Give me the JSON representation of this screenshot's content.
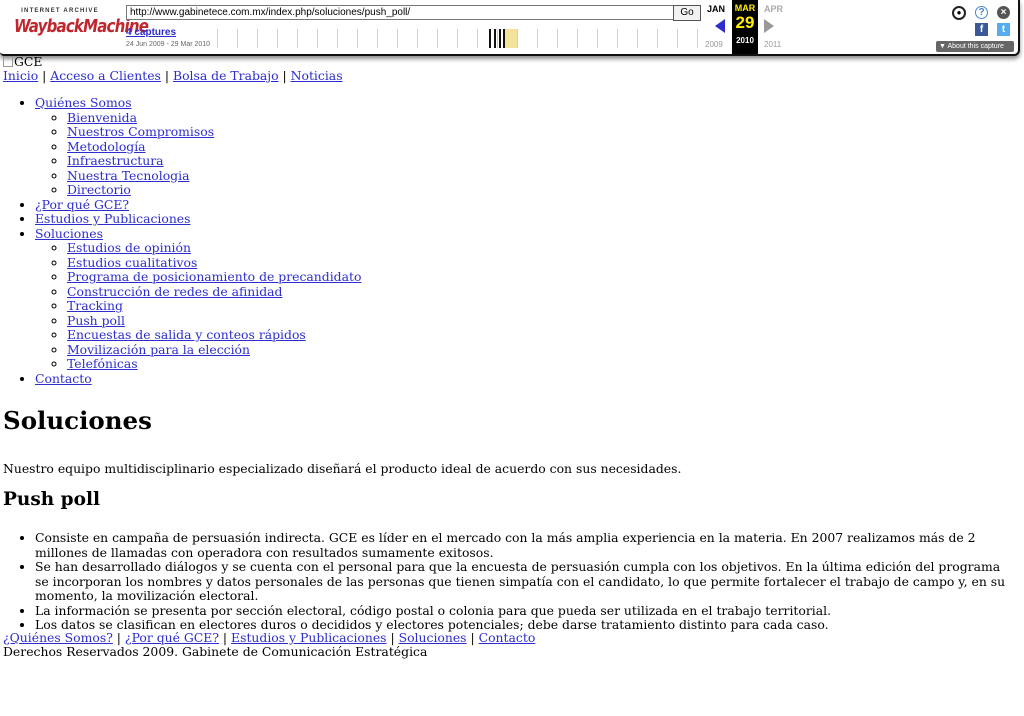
{
  "wayback": {
    "logo_top": "INTERNET ARCHIVE",
    "logo_main": "WaybackMachine",
    "url": "http://www.gabinetece.com.mx/index.php/soluciones/push_poll/",
    "go_label": "Go",
    "captures_label": "4 captures",
    "date_range": "24 Jun 2009 - 29 Mar 2010",
    "month_prev": "JAN",
    "month_current": "MAR",
    "month_next": "APR",
    "day_current": "29",
    "year_prev": "2009",
    "year_current": "2010",
    "year_next": "2011",
    "about_label": "About this capture",
    "icons": {
      "user": "user-icon",
      "help": "help-icon",
      "close": "close-icon",
      "facebook": "facebook-icon",
      "twitter": "twitter-icon"
    },
    "accent_color": "#2c2ccf",
    "highlight_color": "#ffec00"
  },
  "site": {
    "logo_alt": "GCE",
    "topnav": [
      {
        "label": "Inicio"
      },
      {
        "label": "Acceso a Clientes"
      },
      {
        "label": "Bolsa de Trabajo"
      },
      {
        "label": "Noticias"
      }
    ],
    "separator": "|",
    "menu": [
      {
        "label": "Quiénes Somos",
        "children": [
          "Bienvenida",
          "Nuestros Compromisos",
          "Metodología",
          "Infraestructura",
          "Nuestra Tecnologia",
          "Directorio"
        ]
      },
      {
        "label": "¿Por qué GCE?",
        "children": []
      },
      {
        "label": "Estudios y Publicaciones",
        "children": []
      },
      {
        "label": "Soluciones",
        "children": [
          "Estudios de opinión",
          "Estudios cualitativos",
          "Programa de posicionamiento de precandidato",
          "Construcción de redes de afinidad",
          "Tracking",
          "Push poll",
          "Encuestas de salida y conteos rápidos",
          "Movilización para la elección",
          "Telefónicas"
        ]
      },
      {
        "label": "Contacto",
        "children": []
      }
    ],
    "heading": "Soluciones",
    "intro": "Nuestro equipo multidisciplinario especializado diseñará el producto ideal de acuerdo con sus necesidades.",
    "subheading": "Push poll",
    "bullets": [
      "Consiste en campaña de persuasión indirecta. GCE es líder en el mercado con la más amplia experiencia en la materia. En 2007 realizamos más de 2 millones de llamadas con operadora con resultados sumamente exitosos.",
      "Se han desarrollado diálogos y se cuenta con el personal para que la encuesta de persuasión cumpla con los objetivos. En la última edición del programa se incorporan los nombres y datos personales de las personas que tienen simpatía con el candidato, lo que permite fortalecer el trabajo de campo y, en su momento, la movilización electoral.",
      "La información se presenta por sección electoral, código postal o colonia para que pueda ser utilizada en el trabajo territorial.",
      "Los datos se clasifican en electores duros o decididos y electores potenciales; debe darse tratamiento distinto para cada caso."
    ],
    "footnav": [
      {
        "label": "¿Quiénes Somos?"
      },
      {
        "label": "¿Por qué GCE?"
      },
      {
        "label": "Estudios y Publicaciones"
      },
      {
        "label": "Soluciones"
      },
      {
        "label": "Contacto"
      }
    ],
    "copyright": "Derechos Reservados 2009. Gabinete de Comunicación Estratégica",
    "link_color": "#2c2ccf"
  }
}
